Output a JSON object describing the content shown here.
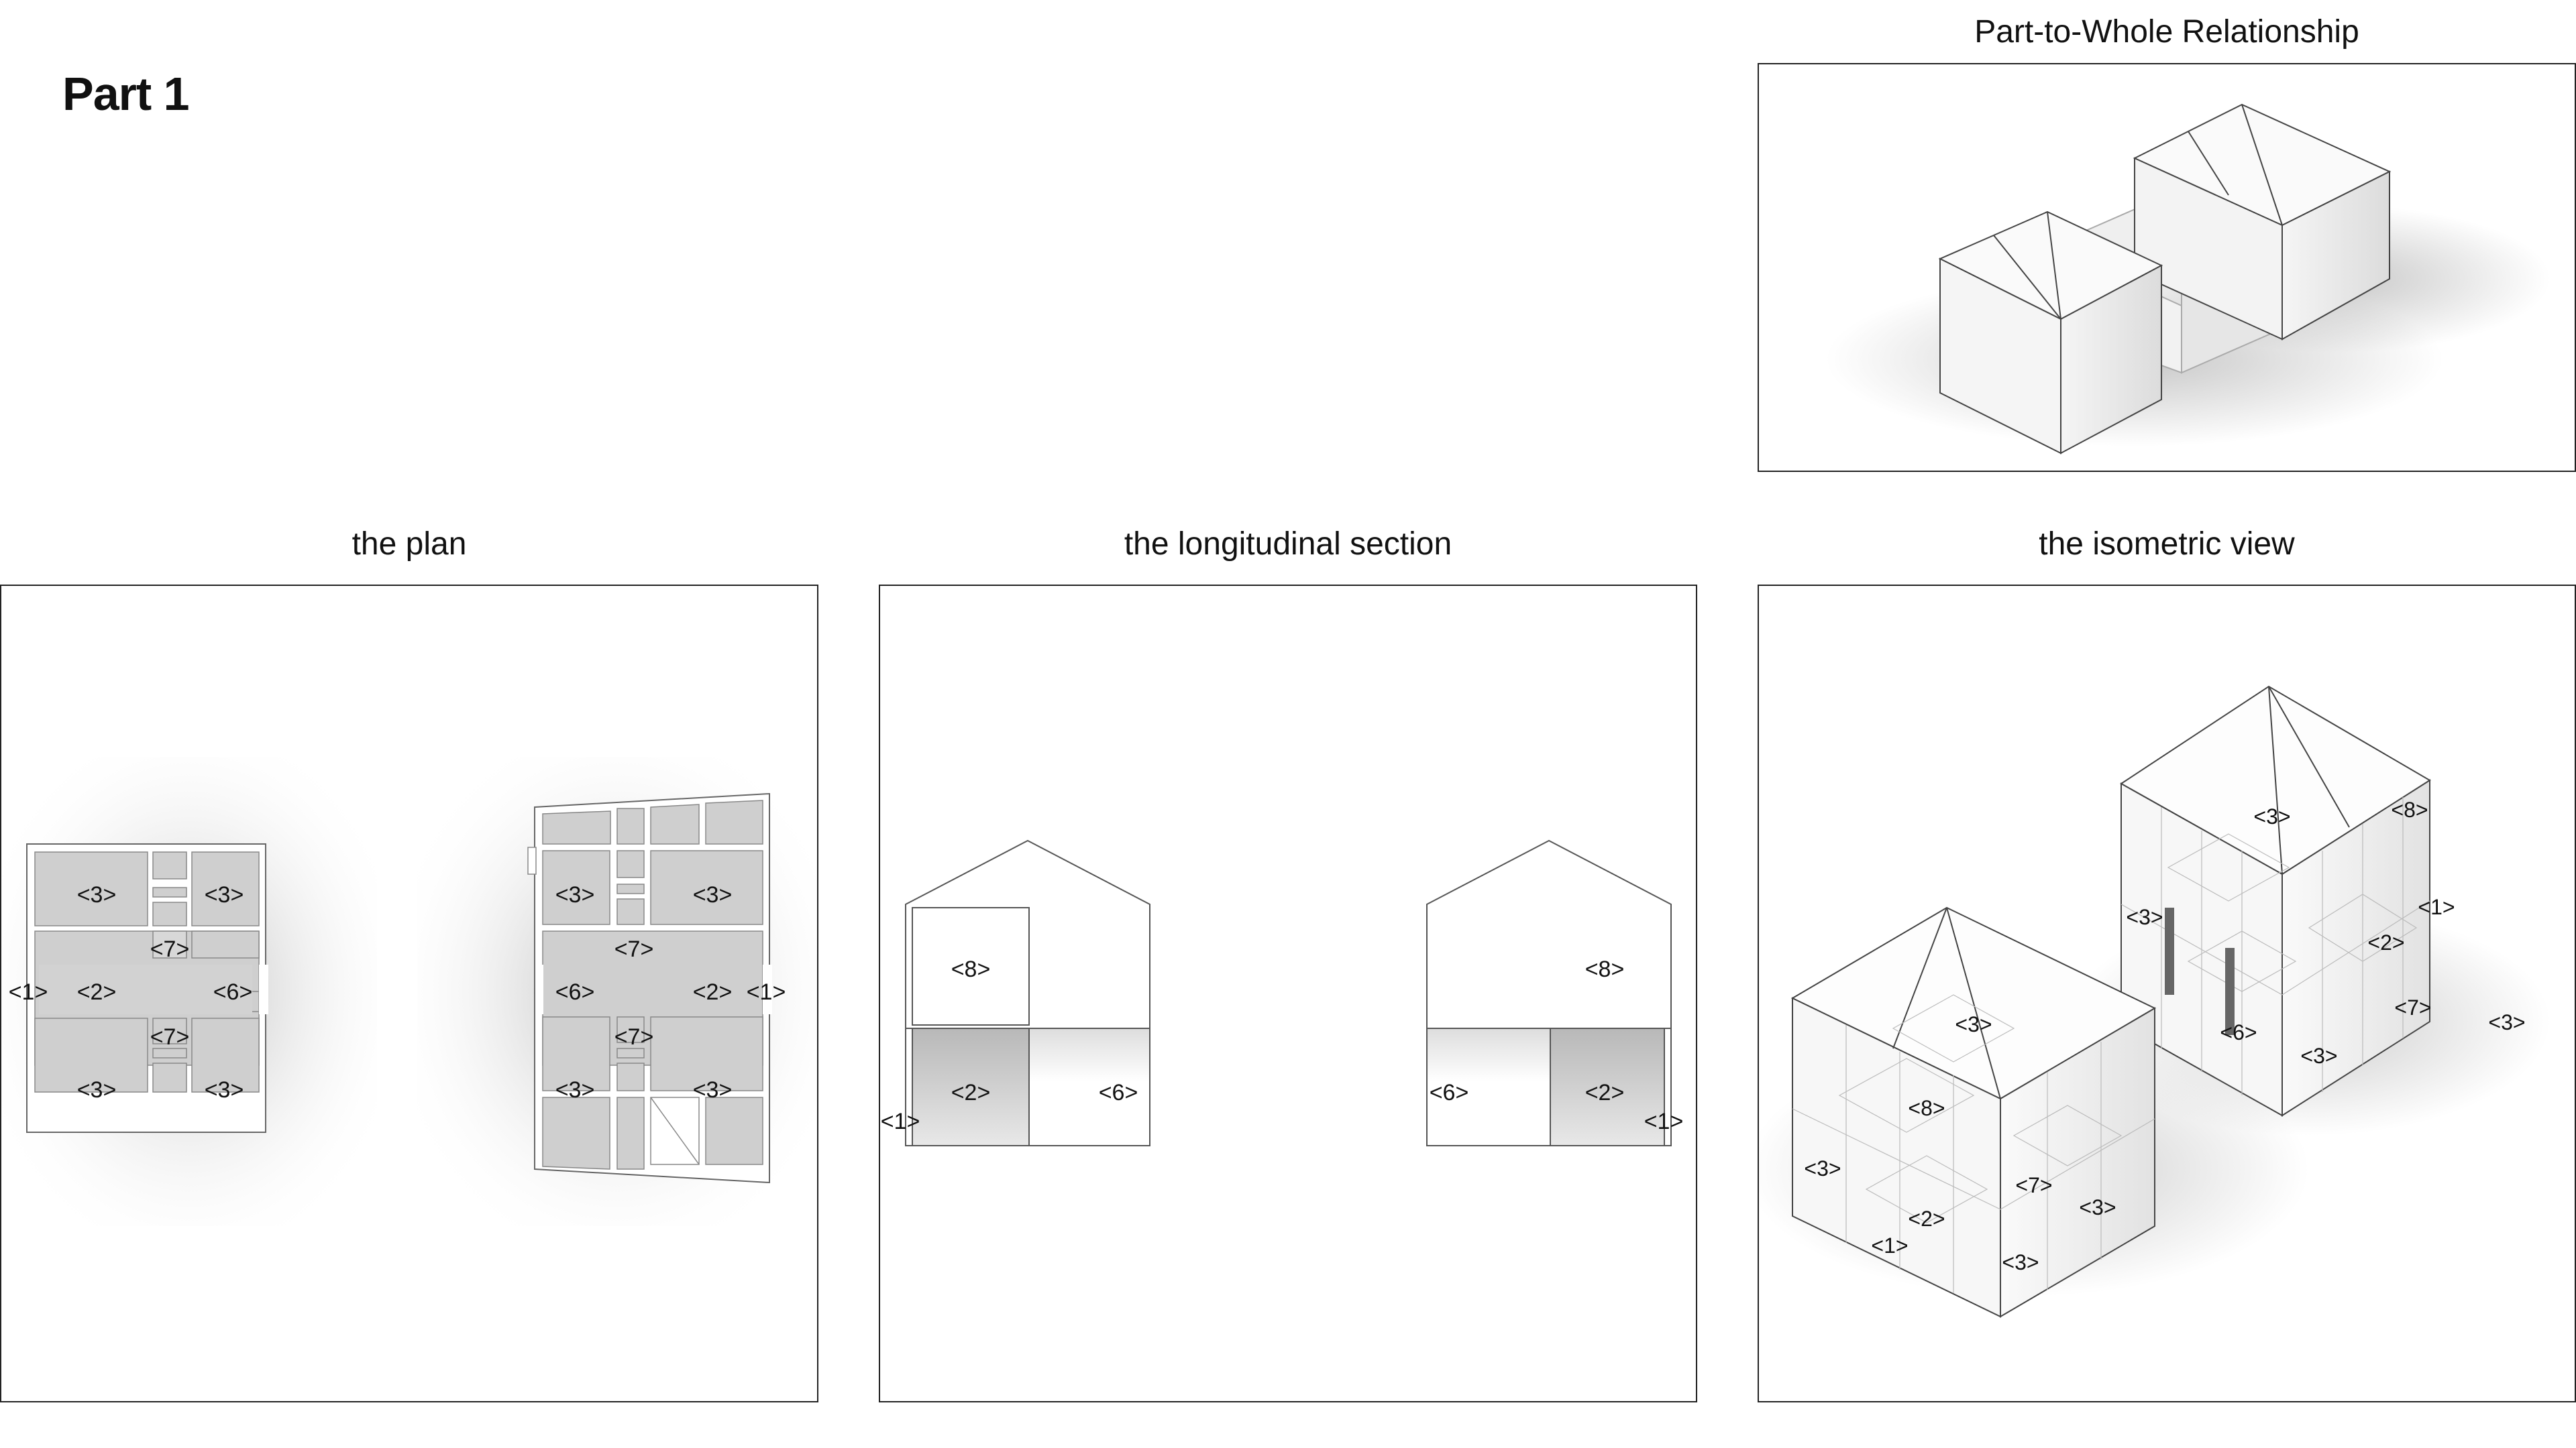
{
  "page": {
    "title": "Part 1"
  },
  "panels": {
    "relationship": {
      "title": "Part-to-Whole Relationship"
    },
    "plan": {
      "title": "the plan",
      "labels": [
        "<3>",
        "<3>",
        "<7>",
        "<1>",
        "<2>",
        "<6>",
        "<7>",
        "<3>",
        "<3>",
        "<3>",
        "<3>",
        "<7>",
        "<6>",
        "<2>",
        "<1>",
        "<7>",
        "<3>",
        "<3>"
      ]
    },
    "section": {
      "title": "the longitudinal section",
      "labels": [
        "<8>",
        "<2>",
        "<6>",
        "<1>",
        "<8>",
        "<6>",
        "<2>",
        "<1>"
      ]
    },
    "isometric": {
      "title": "the isometric view",
      "labels": [
        "<3>",
        "<8>",
        "<1>",
        "<3>",
        "<2>",
        "<7>",
        "<6>",
        "<3>",
        "<3>",
        "<3>",
        "<8>",
        "<3>",
        "<7>",
        "<3>",
        "<2>",
        "<1>",
        "<3>"
      ]
    }
  },
  "colors": {
    "room_fill": "#cfcfcf",
    "wall": "#ffffff",
    "line": "#3a3a3a",
    "frame": "#222222"
  }
}
